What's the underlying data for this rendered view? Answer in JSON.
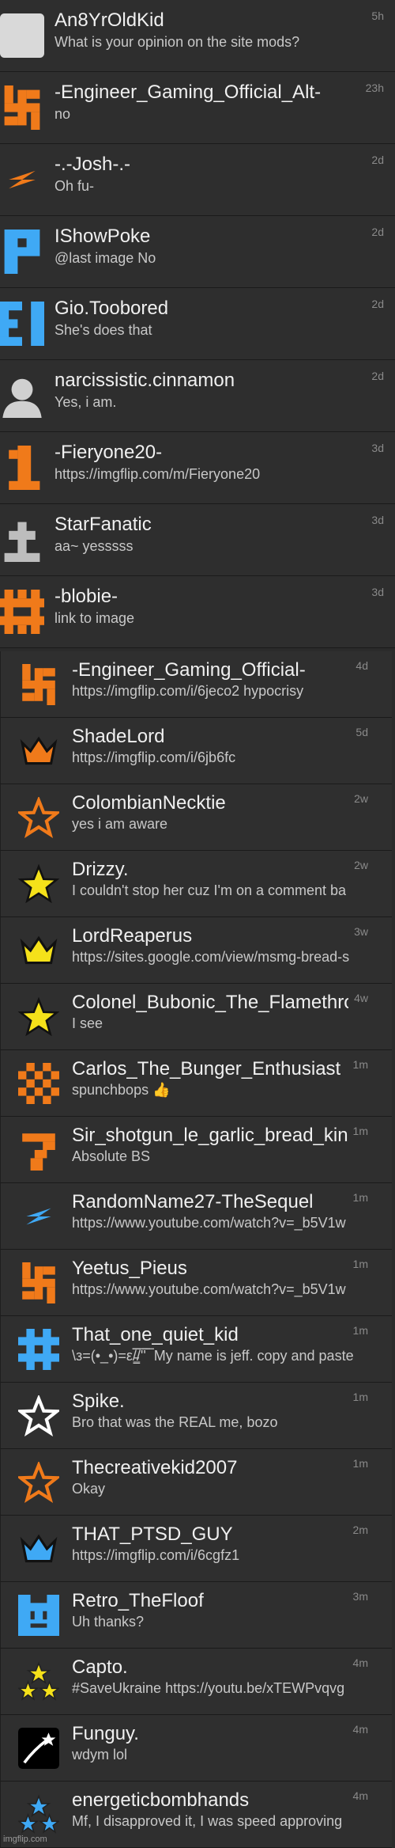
{
  "conversations": [
    {
      "name": "An8YrOldKid",
      "message": "What is your opinion on the site mods?",
      "time": "5h",
      "avatar": "blank-gray-icon"
    },
    {
      "name": "-Engineer_Gaming_Official_Alt-",
      "message": "no",
      "time": "23h",
      "avatar": "orange-pixel-swastika-icon"
    },
    {
      "name": "-.-Josh-.-",
      "message": "Oh fu-",
      "time": "2d",
      "avatar": "orange-bolt-icon"
    },
    {
      "name": "IShowPoke",
      "message": "@last image No",
      "time": "2d",
      "avatar": "blue-p-letter-icon"
    },
    {
      "name": "Gio.Toobored",
      "message": "She's does that",
      "time": "2d",
      "avatar": "blue-ei-glyph-icon"
    },
    {
      "name": "narcissistic.cinnamon",
      "message": "Yes, i am.",
      "time": "2d",
      "avatar": "default-user-icon"
    },
    {
      "name": "-Fieryone20-",
      "message": "https://imgflip.com/m/Fieryone20",
      "time": "3d",
      "avatar": "orange-one-glyph-icon"
    },
    {
      "name": "StarFanatic",
      "message": "aa~ yesssss",
      "time": "3d",
      "avatar": "gray-cross-icon"
    },
    {
      "name": "-blobie-",
      "message": "link to image",
      "time": "3d",
      "avatar": "orange-pixel-grid-icon"
    }
  ],
  "nested_conversations": [
    {
      "name": "-Engineer_Gaming_Official-",
      "message": "https://imgflip.com/i/6jeco2 hypocrisy",
      "time": "4d",
      "avatar": "orange-pixel-swastika-icon"
    },
    {
      "name": "ShadeLord",
      "message": "https://imgflip.com/i/6jb6fc",
      "time": "5d",
      "avatar": "orange-crown-icon"
    },
    {
      "name": "ColombianNecktie",
      "message": "yes i am aware",
      "time": "2w",
      "avatar": "orange-star-outline-icon"
    },
    {
      "name": "Drizzy.",
      "message": "I couldn't stop her cuz I'm on a comment ba",
      "time": "2w",
      "avatar": "yellow-star-icon"
    },
    {
      "name": "LordReaperus",
      "message": "https://sites.google.com/view/msmg-bread-s",
      "time": "3w",
      "avatar": "yellow-crown-icon"
    },
    {
      "name": "Colonel_Bubonic_The_Flamethrower",
      "message": "I see",
      "time": "4w",
      "avatar": "yellow-star-icon"
    },
    {
      "name": "Carlos_The_Bunger_Enthusiast",
      "message": "spunchbops 👍",
      "time": "1m",
      "avatar": "orange-checker-icon"
    },
    {
      "name": "Sir_shotgun_le_garlic_bread_king",
      "message": "Absolute BS",
      "time": "1m",
      "avatar": "orange-seven-glyph-icon"
    },
    {
      "name": "RandomName27-TheSequel",
      "message": "https://www.youtube.com/watch?v=_b5V1w",
      "time": "1m",
      "avatar": "blue-bolt-icon"
    },
    {
      "name": "Yeetus_Pieus",
      "message": "https://www.youtube.com/watch?v=_b5V1w",
      "time": "1m",
      "avatar": "orange-pixel-swastika-icon"
    },
    {
      "name": "That_one_quiet_kid",
      "message": "\\з=(•_•)=ε/̵͇̿̿/'̿'̿ ̿ My name is jeff. copy and paste",
      "time": "1m",
      "avatar": "blue-hash-icon"
    },
    {
      "name": "Spike.",
      "message": "Bro that was the REAL me, bozo",
      "time": "1m",
      "avatar": "white-star-outline-icon"
    },
    {
      "name": "Thecreativekid2007",
      "message": "Okay",
      "time": "1m",
      "avatar": "orange-star-outline-icon"
    },
    {
      "name": "THAT_PTSD_GUY",
      "message": "https://imgflip.com/i/6cgfz1",
      "time": "2m",
      "avatar": "blue-crown-icon"
    },
    {
      "name": "Retro_TheFloof",
      "message": "Uh thanks?",
      "time": "3m",
      "avatar": "blue-pixel-face-icon"
    },
    {
      "name": "Capto.",
      "message": "#SaveUkraine https://youtu.be/xTEWPvqvg",
      "time": "4m",
      "avatar": "yellow-three-stars-icon"
    },
    {
      "name": "Funguy.",
      "message": "wdym lol",
      "time": "4m",
      "avatar": "white-shooting-star-icon"
    },
    {
      "name": "energeticbombhands",
      "message": "Mf, I disapproved it, I was speed approving",
      "time": "4m",
      "avatar": "blue-three-stars-icon"
    }
  ],
  "footer": "imgflip.com"
}
